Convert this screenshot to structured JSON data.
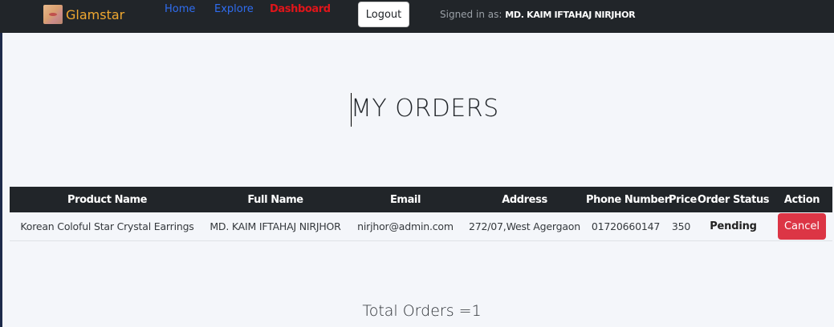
{
  "navbar": {
    "brand": {
      "name": "Glamstar",
      "logo_icon": "lips-logo-icon"
    },
    "links": {
      "home": "Home",
      "explore": "Explore",
      "dashboard": "Dashboard"
    },
    "logout_label": "Logout",
    "signed_in_prefix": "Signed in as:",
    "signed_in_user": "MD. KAIM IFTAHAJ NIRJHOR"
  },
  "main": {
    "title": "MY ORDERS",
    "table": {
      "headers": [
        "Product Name",
        "Full Name",
        "Email",
        "Address",
        "Phone Number",
        "Price",
        "Order Status",
        "Action"
      ],
      "rows": [
        {
          "product_name": "Korean Coloful Star Crystal Earrings",
          "full_name": "MD. KAIM IFTAHAJ NIRJHOR",
          "email": "nirjhor@admin.com",
          "address": "272/07,West Agergaon",
          "phone": "01720660147",
          "price": "350",
          "status": "Pending",
          "action_label": "Cancel"
        }
      ]
    },
    "total_orders": "Total Orders =1"
  },
  "colors": {
    "navbar_bg": "#212529",
    "brand": "#f0a830",
    "link": "#2f6df0",
    "active_link": "#e0151a",
    "danger": "#dc3545",
    "page_bg": "#f4f6fa"
  }
}
